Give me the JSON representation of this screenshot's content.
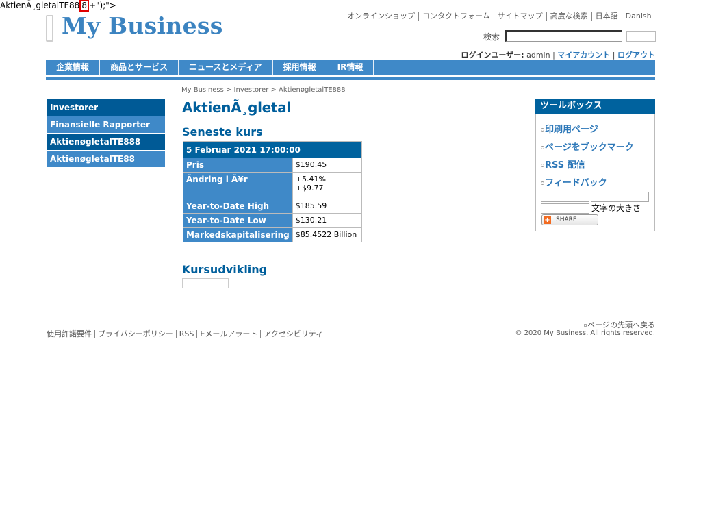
{
  "injected": {
    "before": "AktienÃ¸gletalTE88",
    "boxed": "8",
    "after": "+\");\">"
  },
  "header": {
    "logo_text": "My Business",
    "util_links": [
      "オンラインショップ",
      "コンタクトフォーム",
      "サイトマップ",
      "高度な検索",
      "日本語",
      "Danish"
    ],
    "search_label": "検索",
    "search_value": "",
    "login_label": "ログインユーザー:",
    "login_user": "admin",
    "my_account": "マイアカウント",
    "logout": "ログアウト",
    "sep": "|"
  },
  "nav": [
    "企業情報",
    "商品とサービス",
    "ニュースとメディア",
    "採用情報",
    "IR情報"
  ],
  "breadcrumb": "My Business > Investorer > AktienøgletalTE888",
  "leftnav": [
    "Investorer",
    "Finansielle Rapporter",
    "AktienøgletalTE888",
    "AktienøgletalTE88"
  ],
  "main": {
    "title": "AktienÃ¸gletal",
    "section1": "Seneste kurs",
    "section2": "Kursudvikling",
    "table": {
      "header": "5 Februar 2021  17:00:00",
      "rows": [
        {
          "label": "Pris",
          "value": "$190.45"
        },
        {
          "label": "Ãndring i Ã¥r",
          "value": "+5.41%",
          "value2": "+$9.77"
        },
        {
          "label": "Year-to-Date High",
          "value": "$185.59"
        },
        {
          "label": "Year-to-Date Low",
          "value": "$130.21"
        },
        {
          "label": "Markedskapitalisering",
          "value": "$85.4522 Billion"
        }
      ]
    }
  },
  "toolbox": {
    "title": "ツールボックス",
    "items": [
      "印刷用ページ",
      "ページをブックマーク",
      "RSS 配信",
      "フィードバック"
    ],
    "font_size_label": "文字の大きさ",
    "share_label": "SHARE",
    "share_plus": "+"
  },
  "footer": {
    "back_to_top": "ページの先頭へ戻る",
    "links": [
      "使用許諾要件",
      "プライバシーポリシー",
      "RSS",
      "Eメールアラート",
      "アクセシビリティ"
    ],
    "copyright": "© 2020 My Business. All rights reserved."
  },
  "colors": {
    "brand": "#3f89c8",
    "dark": "#00629e",
    "title": "#005f9c",
    "positive": "#007a00"
  }
}
